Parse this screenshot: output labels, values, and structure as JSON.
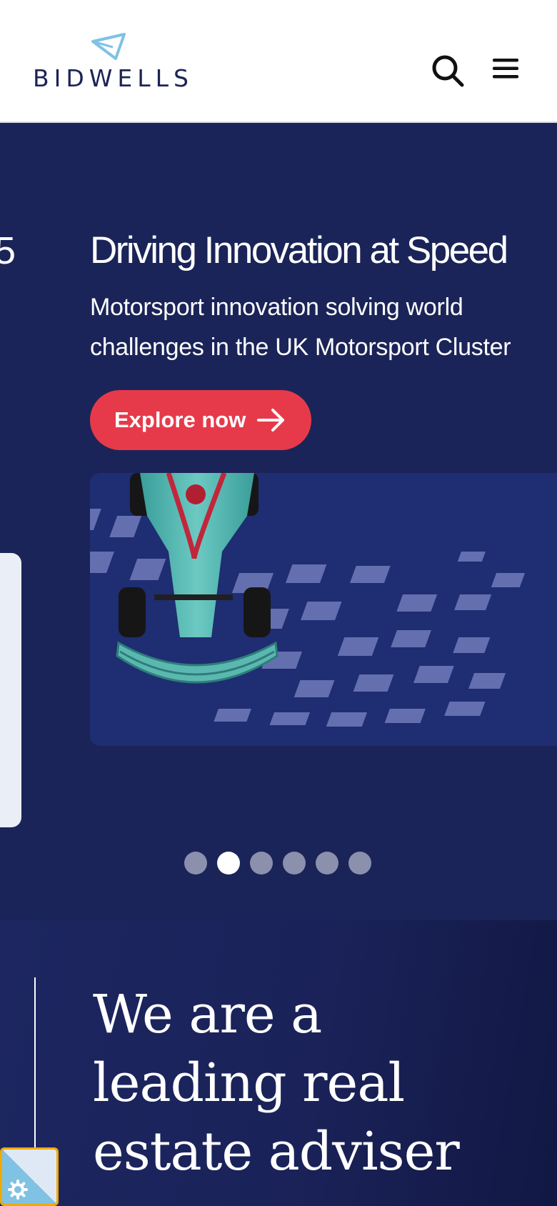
{
  "header": {
    "logo_text": "BIDWELLS",
    "logo_icon": "paper-plane-triangle-icon",
    "search_icon": "search-icon",
    "menu_icon": "menu-icon"
  },
  "hero": {
    "previous_slide_fragment": "5",
    "title": "Driving Innovation at Speed",
    "subtitle": "Motorsport innovation solving world challenges in the UK Motorsport Cluster",
    "cta_label": "Explore now",
    "cta_icon": "arrow-right-icon",
    "slide_count": 6,
    "active_slide": 2
  },
  "about": {
    "heading_lines": [
      "We are a",
      "leading real",
      "estate adviser"
    ]
  },
  "cookie": {
    "icon": "gear-icon"
  },
  "colors": {
    "navy": "#1b2458",
    "brand_text": "#1c2454",
    "logo_accent": "#7fc2e3",
    "cta_red": "#e63a4a",
    "focus_outline": "#f2a900"
  }
}
